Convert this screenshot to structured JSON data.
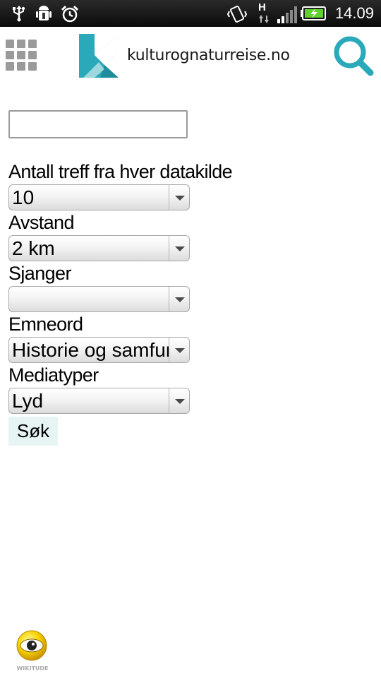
{
  "status_bar": {
    "time": "14.09",
    "icons": [
      "usb-icon",
      "android-debug-icon",
      "alarm-icon",
      "vibrate-icon",
      "h-data-icon",
      "signal-icon",
      "battery-charging-icon"
    ],
    "network_label": "H"
  },
  "header": {
    "logo_text": "kulturognaturreise.no",
    "brand_color": "#29a9b9",
    "menu_icon": "grid-icon",
    "search_icon": "search-icon"
  },
  "form": {
    "search_value": "",
    "fields": [
      {
        "label": "Antall treff fra hver datakilde",
        "value": "10"
      },
      {
        "label": "Avstand",
        "value": "2 km"
      },
      {
        "label": "Sjanger",
        "value": ""
      },
      {
        "label": "Emneord",
        "value": "Historie og samfunn"
      },
      {
        "label": "Mediatyper",
        "value": "Lyd"
      }
    ],
    "submit_label": "Søk",
    "submit_bg": "#e7f4f4"
  },
  "footer": {
    "logo_icon": "eye-logo-icon",
    "logo_text": "WIKITUDE"
  }
}
